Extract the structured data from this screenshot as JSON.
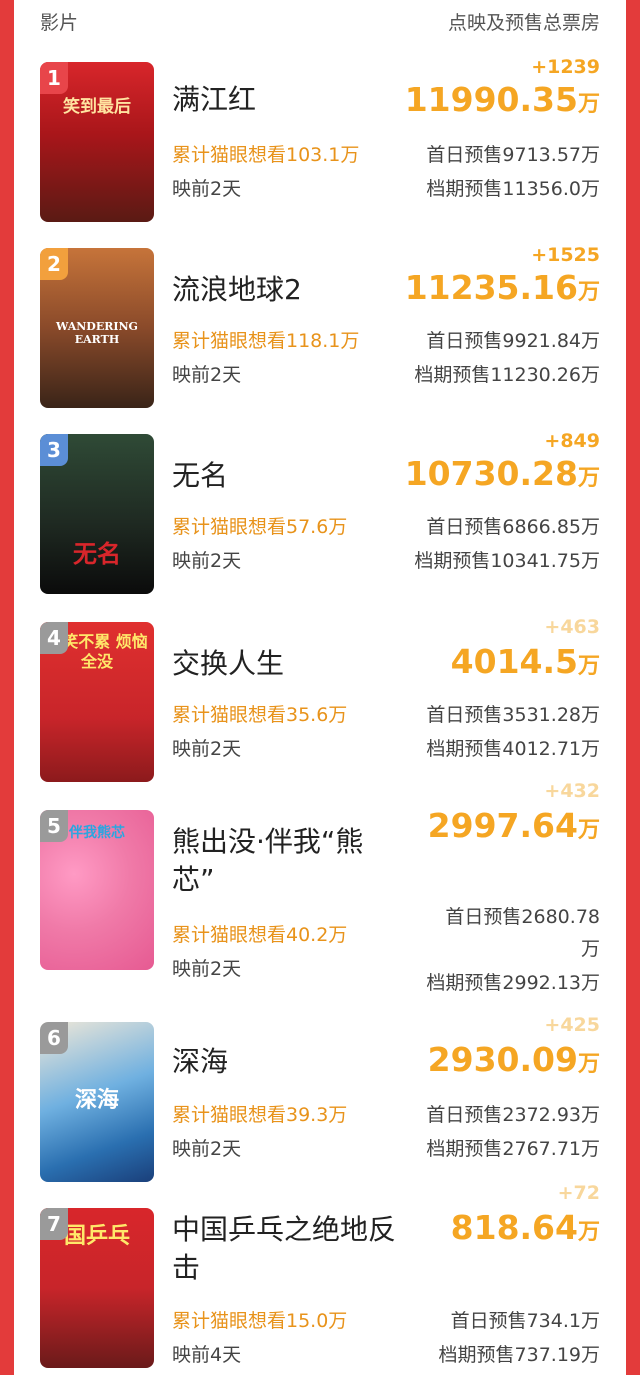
{
  "header": {
    "left": "影片",
    "right": "点映及预售总票房"
  },
  "unit": "万",
  "movies": [
    {
      "rank": "1",
      "rank_color": "#e8454a",
      "title": "满江红",
      "want": "累计猫眼想看103.1万",
      "days": "映前2天",
      "delta": "+1239",
      "total": "11990.35",
      "first_day": "首日预售9713.57万",
      "period": "档期预售11356.0万",
      "poster_text": "笑到最后",
      "poster_color": "#b5181b"
    },
    {
      "rank": "2",
      "rank_color": "#f2a03d",
      "title": "流浪地球2",
      "want": "累计猫眼想看118.1万",
      "days": "映前2天",
      "delta": "+1525",
      "total": "11235.16",
      "first_day": "首日预售9921.84万",
      "period": "档期预售11230.26万",
      "poster_text": "WANDERING EARTH",
      "poster_color": "#8a4a2a"
    },
    {
      "rank": "3",
      "rank_color": "#5b8ed6",
      "title": "无名",
      "want": "累计猫眼想看57.6万",
      "days": "映前2天",
      "delta": "+849",
      "total": "10730.28",
      "first_day": "首日预售6866.85万",
      "period": "档期预售10341.75万",
      "poster_text": "无名",
      "poster_color": "#1f2a22"
    },
    {
      "rank": "4",
      "rank_color": "#9a9a9a",
      "title": "交换人生",
      "want": "累计猫眼想看35.6万",
      "days": "映前2天",
      "delta": "+463",
      "total": "4014.5",
      "first_day": "首日预售3531.28万",
      "period": "档期预售4012.71万",
      "poster_text": "好笑不累 烦恼全没",
      "poster_color": "#d8262b"
    },
    {
      "rank": "5",
      "rank_color": "#9a9a9a",
      "title_line1": "熊出没·伴我“熊",
      "title_line2": "芯”",
      "want": "累计猫眼想看40.2万",
      "days": "映前2天",
      "delta": "+432",
      "total": "2997.64",
      "first_day_line1": "首日预售2680.78",
      "first_day_line2": "万",
      "period": "档期预售2992.13万",
      "poster_text": "伴我熊芯",
      "poster_color": "#f07aa8"
    },
    {
      "rank": "6",
      "rank_color": "#9a9a9a",
      "title": "深海",
      "want": "累计猫眼想看39.3万",
      "days": "映前2天",
      "delta": "+425",
      "total": "2930.09",
      "first_day": "首日预售2372.93万",
      "period": "档期预售2767.71万",
      "poster_text": "深海",
      "poster_color": "#3a86c8"
    },
    {
      "rank": "7",
      "rank_color": "#9a9a9a",
      "title_line1": "中国乒乓之绝地反",
      "title_line2": "击",
      "want": "累计猫眼想看15.0万",
      "days": "映前4天",
      "delta": "+72",
      "total": "818.64",
      "first_day": "首日预售734.1万",
      "period": "档期预售737.19万",
      "poster_text": "国乒乓",
      "poster_color": "#c8252a"
    }
  ],
  "colors": {
    "accent": "#f5a623",
    "want": "#e8931b",
    "background": "#e33b3b"
  }
}
